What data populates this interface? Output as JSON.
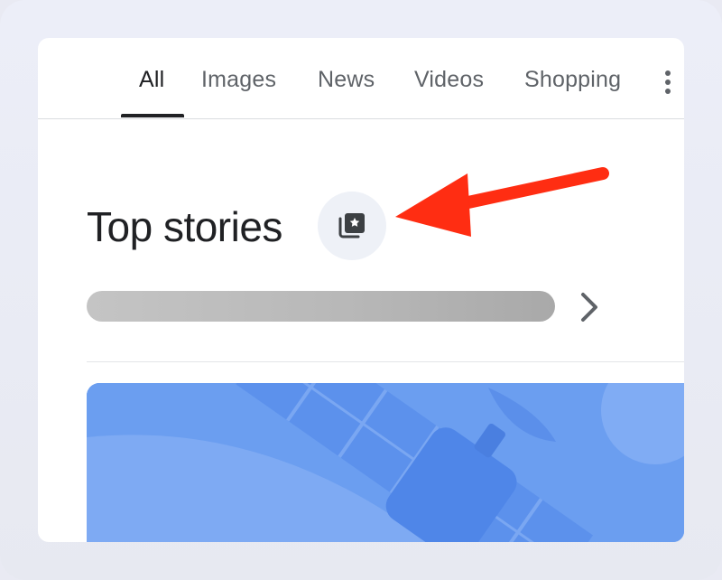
{
  "tabs": [
    {
      "label": "All",
      "active": true
    },
    {
      "label": "Images",
      "active": false
    },
    {
      "label": "News",
      "active": false
    },
    {
      "label": "Videos",
      "active": false
    },
    {
      "label": "Shopping",
      "active": false
    }
  ],
  "more_icon": "more-vert-icon",
  "section": {
    "title": "Top stories",
    "icon": "stories-collection-icon"
  },
  "annotation": {
    "icon": "arrow-icon",
    "color": "#ff2d12"
  },
  "navigation_icon": "chevron-right-icon",
  "colors": {
    "text_primary": "#202124",
    "text_secondary": "#5f6368",
    "icon_bg": "#eef1f7",
    "image_blue": "#6b9ef0"
  }
}
